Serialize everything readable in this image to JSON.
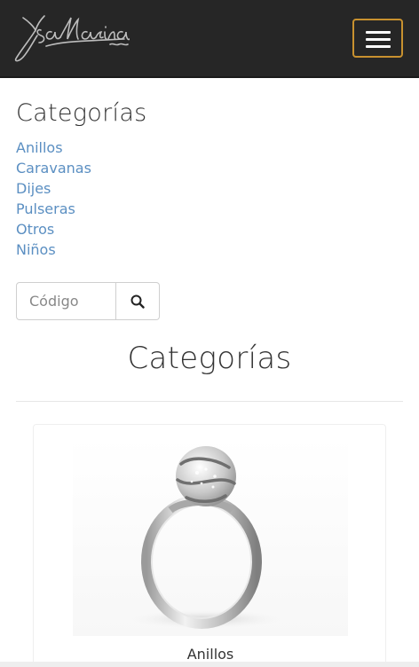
{
  "navbar": {
    "logo_text": "YsaMarina",
    "menu_toggle_icon": "hamburger-icon",
    "accent_color": "#c8912f",
    "background_color": "#262626"
  },
  "sidebar": {
    "title": "Categorías",
    "categories": [
      {
        "label": "Anillos"
      },
      {
        "label": "Caravanas"
      },
      {
        "label": "Dijes"
      },
      {
        "label": "Pulseras"
      },
      {
        "label": "Otros"
      },
      {
        "label": "Niños"
      }
    ],
    "link_color": "#5b8fc2"
  },
  "search": {
    "placeholder": "Código",
    "button_icon": "search-icon"
  },
  "main": {
    "title": "Categorías",
    "cards": [
      {
        "caption": "Anillos",
        "image": "ring-product-image"
      }
    ]
  }
}
